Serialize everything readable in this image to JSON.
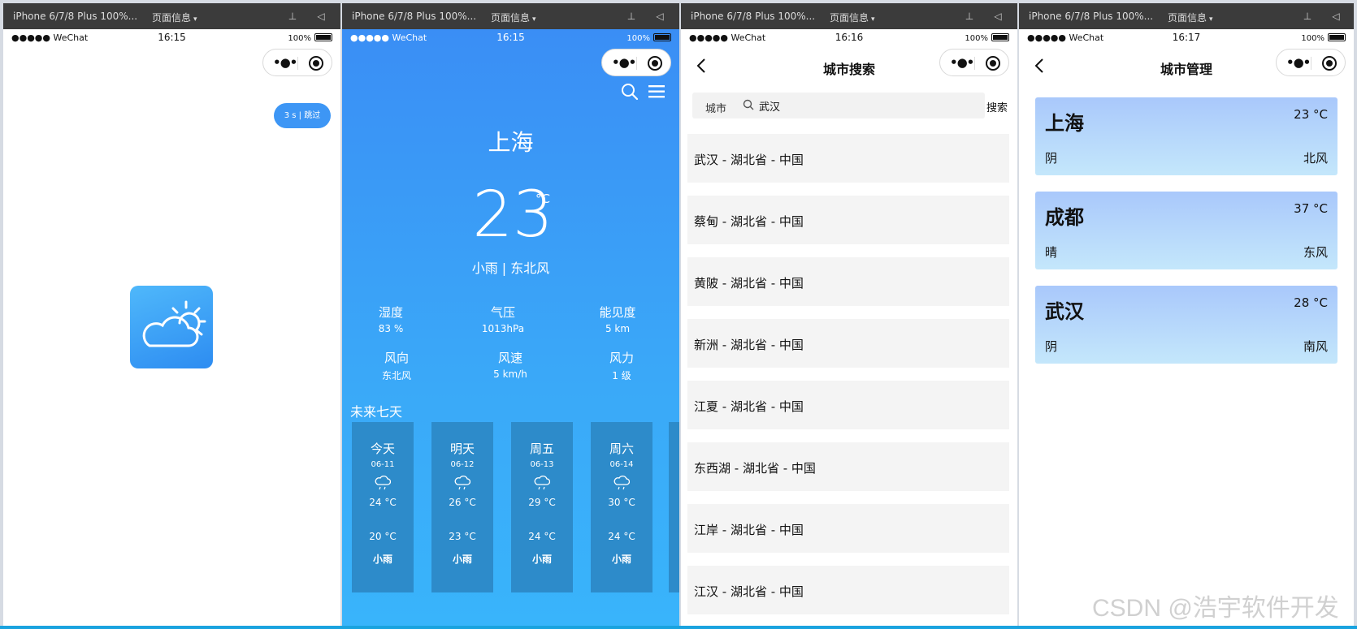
{
  "devtools": {
    "device": "iPhone 6/7/8 Plus 100%...",
    "page_info": "页面信息"
  },
  "status_bar": {
    "carrier": "●●●●● WeChat",
    "battery": "100%",
    "times": [
      "16:15",
      "16:15",
      "16:16",
      "16:17"
    ]
  },
  "splash": {
    "skip_label": "3 s | 跳过"
  },
  "weather": {
    "city": "上海",
    "temp": "23",
    "unit": "°C",
    "condition": "小雨 | 东北风",
    "stats": [
      {
        "label": "湿度",
        "value": "83 %"
      },
      {
        "label": "气压",
        "value": "1013hPa"
      },
      {
        "label": "能见度",
        "value": "5 km"
      },
      {
        "label": "风向",
        "value": "东北风"
      },
      {
        "label": "风速",
        "value": "5 km/h"
      },
      {
        "label": "风力",
        "value": "1 级"
      }
    ],
    "future_title": "未来七天",
    "days": [
      {
        "name": "今天",
        "date": "06-11",
        "high": "24 °C",
        "low": "20 °C",
        "desc": "小雨"
      },
      {
        "name": "明天",
        "date": "06-12",
        "high": "26 °C",
        "low": "23 °C",
        "desc": "小雨"
      },
      {
        "name": "周五",
        "date": "06-13",
        "high": "29 °C",
        "low": "24 °C",
        "desc": "小雨"
      },
      {
        "name": "周六",
        "date": "06-14",
        "high": "30 °C",
        "low": "24 °C",
        "desc": "小雨"
      }
    ]
  },
  "search": {
    "title": "城市搜索",
    "city_label": "城市",
    "query": "武汉",
    "button": "搜索",
    "results": [
      "武汉 - 湖北省 - 中国",
      "蔡甸 - 湖北省 - 中国",
      "黄陂 - 湖北省 - 中国",
      "新洲 - 湖北省 - 中国",
      "江夏 - 湖北省 - 中国",
      "东西湖 - 湖北省 - 中国",
      "江岸 - 湖北省 - 中国",
      "江汉 - 湖北省 - 中国"
    ]
  },
  "manage": {
    "title": "城市管理",
    "cities": [
      {
        "name": "上海",
        "temp": "23 °C",
        "weather": "阴",
        "wind": "北风"
      },
      {
        "name": "成都",
        "temp": "37 °C",
        "weather": "晴",
        "wind": "东风"
      },
      {
        "name": "武汉",
        "temp": "28 °C",
        "weather": "阴",
        "wind": "南风"
      }
    ]
  },
  "watermark": "CSDN @浩宇软件开发"
}
